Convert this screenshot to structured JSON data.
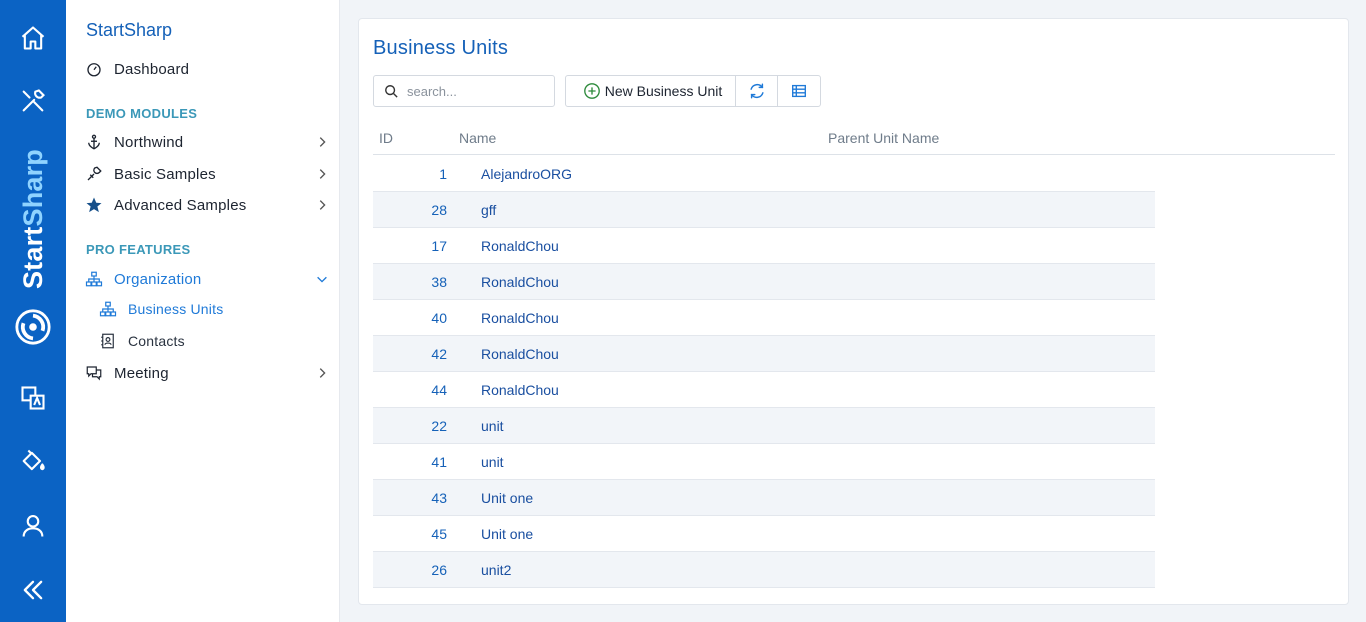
{
  "rail": {
    "brand_part1": "Start",
    "brand_part2": "Sharp",
    "icons": [
      "home-icon",
      "tools-icon",
      "translate-icon",
      "paint-bucket-icon",
      "user-icon",
      "collapse-icon"
    ]
  },
  "sidebar": {
    "app_title": "StartSharp",
    "dashboard": "Dashboard",
    "section_demo": "DEMO MODULES",
    "northwind": "Northwind",
    "basic_samples": "Basic Samples",
    "advanced_samples": "Advanced Samples",
    "section_pro": "PRO FEATURES",
    "organization": "Organization",
    "business_units": "Business Units",
    "contacts": "Contacts",
    "meeting": "Meeting"
  },
  "page": {
    "title": "Business Units",
    "search_placeholder": "search...",
    "new_button": "New Business Unit"
  },
  "grid": {
    "headers": {
      "id": "ID",
      "name": "Name",
      "parent": "Parent Unit Name"
    },
    "rows": [
      {
        "id": "1",
        "name": "AlejandroORG"
      },
      {
        "id": "28",
        "name": "gff"
      },
      {
        "id": "17",
        "name": "RonaldChou"
      },
      {
        "id": "38",
        "name": "RonaldChou"
      },
      {
        "id": "40",
        "name": "RonaldChou"
      },
      {
        "id": "42",
        "name": "RonaldChou"
      },
      {
        "id": "44",
        "name": "RonaldChou"
      },
      {
        "id": "22",
        "name": "unit"
      },
      {
        "id": "41",
        "name": "unit"
      },
      {
        "id": "43",
        "name": "Unit one"
      },
      {
        "id": "45",
        "name": "Unit one"
      },
      {
        "id": "26",
        "name": "unit2"
      }
    ]
  },
  "colors": {
    "rail_bg": "#0b63c4",
    "accent": "#1561b8",
    "section": "#3b98b8",
    "link": "#1a4fa0"
  }
}
